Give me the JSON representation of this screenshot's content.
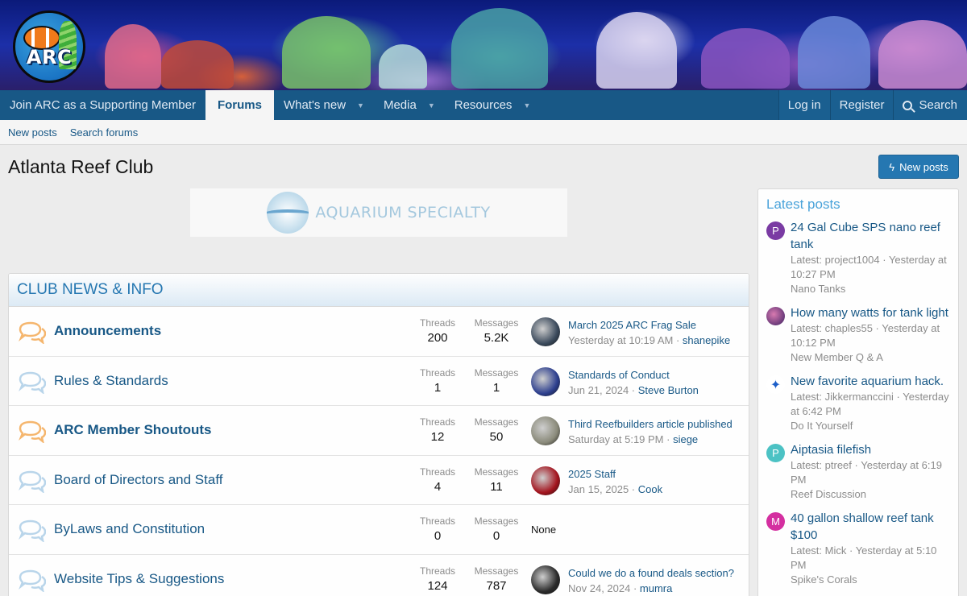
{
  "banner": {
    "logo_text": "ARC"
  },
  "nav": {
    "items": [
      {
        "label": "Join ARC as a Supporting Member",
        "caret": false
      },
      {
        "label": "Forums",
        "caret": false,
        "active": true
      },
      {
        "label": "What's new",
        "caret": true
      },
      {
        "label": "Media",
        "caret": true
      },
      {
        "label": "Resources",
        "caret": true
      }
    ],
    "login": "Log in",
    "register": "Register",
    "search": "Search"
  },
  "subnav": {
    "new_posts": "New posts",
    "search_forums": "Search forums"
  },
  "page": {
    "title": "Atlanta Reef Club",
    "new_posts_button": "New posts"
  },
  "ad": {
    "text": "AQUARIUM SPECIALTY"
  },
  "category": {
    "title": "CLUB NEWS & INFO",
    "threads_label": "Threads",
    "messages_label": "Messages",
    "nodes": [
      {
        "title": "Announcements",
        "unread": true,
        "threads": "200",
        "messages": "5.2K",
        "last_title": "March 2025 ARC Frag Sale",
        "last_date": "Yesterday at 10:19 AM",
        "last_user": "shanepike",
        "avatar_color": "#3b4a5c"
      },
      {
        "title": "Rules & Standards",
        "unread": false,
        "threads": "1",
        "messages": "1",
        "last_title": "Standards of Conduct",
        "last_date": "Jun 21, 2024",
        "last_user": "Steve Burton",
        "avatar_color": "#2d3f8e"
      },
      {
        "title": "ARC Member Shoutouts",
        "unread": true,
        "threads": "12",
        "messages": "50",
        "last_title": "Third Reefbuilders article published",
        "last_date": "Saturday at 5:19 PM",
        "last_user": "siege",
        "avatar_color": "#8a8a7a"
      },
      {
        "title": "Board of Directors and Staff",
        "unread": false,
        "threads": "4",
        "messages": "11",
        "last_title": "2025 Staff",
        "last_date": "Jan 15, 2025",
        "last_user": "Cook",
        "avatar_color": "#a3141e"
      },
      {
        "title": "ByLaws and Constitution",
        "unread": false,
        "threads": "0",
        "messages": "0",
        "last_title": "",
        "last_date": "",
        "last_user": "",
        "none_text": "None"
      },
      {
        "title": "Website Tips & Suggestions",
        "unread": false,
        "threads": "124",
        "messages": "787",
        "last_title": "Could we do a found deals section?",
        "last_date": "Nov 24, 2024",
        "last_user": "mumra",
        "avatar_color": "#2a2a2a"
      }
    ]
  },
  "sidebar": {
    "title": "Latest posts",
    "latest_prefix": "Latest:",
    "items": [
      {
        "avatar_letter": "P",
        "avatar_color": "#7a3ba3",
        "title": "24 Gal Cube SPS nano reef tank",
        "user": "project1004",
        "date": "Yesterday at 10:27 PM",
        "forum": "Nano Tanks"
      },
      {
        "avatar_letter": "",
        "avatar_color": "#8a5a8f",
        "title": "How many watts for tank light",
        "user": "chaples55",
        "date": "Yesterday at 10:12 PM",
        "forum": "New Member Q & A"
      },
      {
        "avatar_letter": "",
        "avatar_color": "#ffffff",
        "title": "New favorite aquarium hack.",
        "user": "Jikkermanccini",
        "date": "Yesterday at 6:42 PM",
        "forum": "Do It Yourself"
      },
      {
        "avatar_letter": "P",
        "avatar_color": "#4cc2c4",
        "title": "Aiptasia filefish",
        "user": "ptreef",
        "date": "Yesterday at 6:19 PM",
        "forum": "Reef Discussion"
      },
      {
        "avatar_letter": "M",
        "avatar_color": "#d42fa0",
        "title": "40 gallon shallow reef tank $100",
        "user": "Mick",
        "date": "Yesterday at 5:10 PM",
        "forum": "Spike's Corals"
      }
    ]
  }
}
